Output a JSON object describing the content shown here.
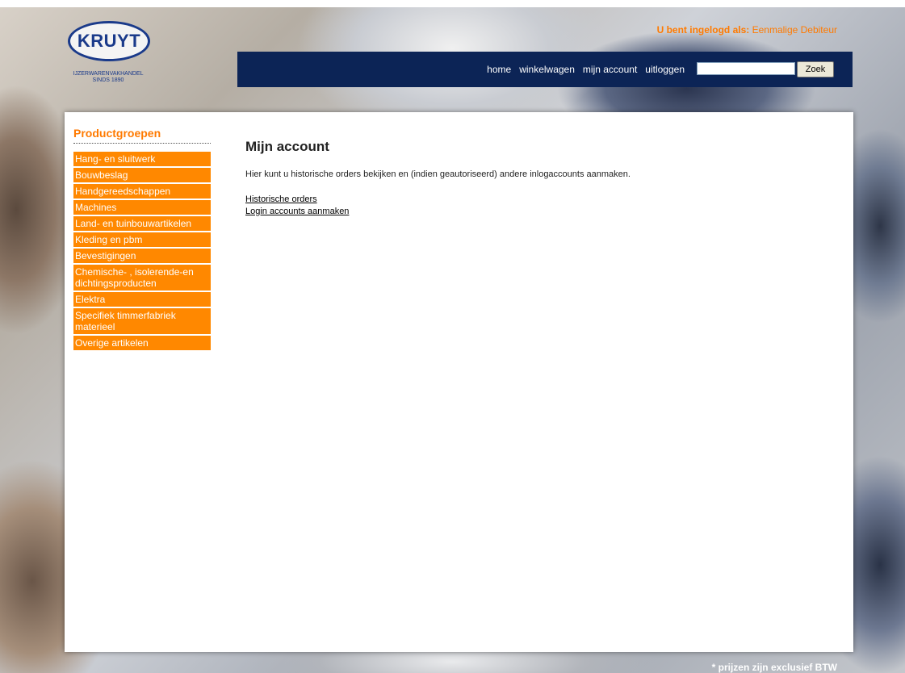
{
  "brand": {
    "logo_text": "KRUYT",
    "tagline_line1": "IJZERWARENVAKHANDEL",
    "tagline_line2": "SINDS 1890"
  },
  "login_status": {
    "label": "U bent ingelogd als:",
    "user": "Eenmalige Debiteur"
  },
  "nav": {
    "home": "home",
    "cart": "winkelwagen",
    "account": "mijn account",
    "logout": "uitloggen"
  },
  "search": {
    "value": "",
    "button_label": "Zoek"
  },
  "sidebar": {
    "title": "Productgroepen",
    "items": [
      "Hang- en sluitwerk",
      "Bouwbeslag",
      "Handgereedschappen",
      "Machines",
      "Land- en tuinbouwartikelen",
      "Kleding en pbm",
      "Bevestigingen",
      "Chemische- , isolerende-en dichtingsproducten",
      "Elektra",
      "Specifiek timmerfabriek materieel",
      "Overige artikelen"
    ]
  },
  "main": {
    "title": "Mijn account",
    "description": "Hier kunt u historische orders bekijken en (indien geautoriseerd) andere inlogaccounts aanmaken.",
    "links": {
      "orders": "Historische orders",
      "create_accounts": "Login accounts aanmaken"
    }
  },
  "footer": {
    "note": "* prijzen zijn exclusief BTW"
  },
  "colors": {
    "accent_orange": "#ff8800",
    "navbar_navy": "#0c2456",
    "logo_blue": "#1a3a8a"
  }
}
